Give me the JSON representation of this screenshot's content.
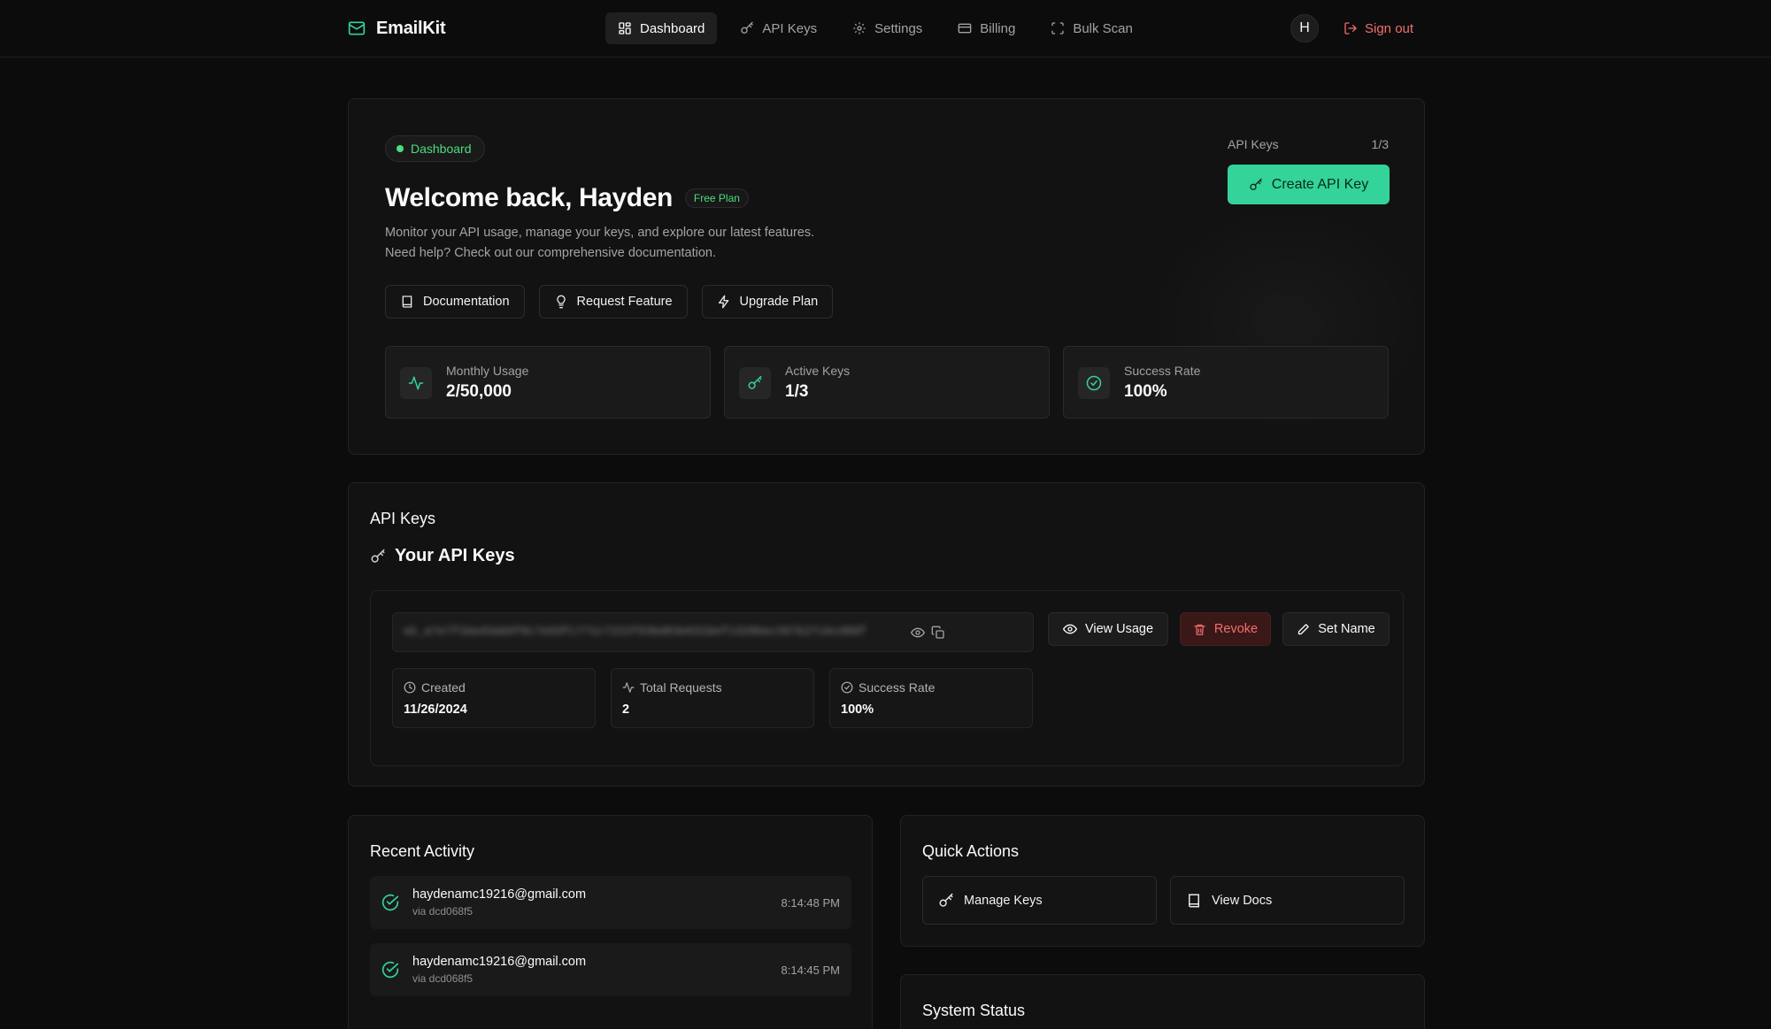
{
  "app": {
    "name": "EmailKit"
  },
  "nav": {
    "links": [
      {
        "label": "Dashboard",
        "icon": "dashboard-icon",
        "active": true
      },
      {
        "label": "API Keys",
        "icon": "key-icon"
      },
      {
        "label": "Settings",
        "icon": "gear-icon"
      },
      {
        "label": "Billing",
        "icon": "credit-card-icon"
      },
      {
        "label": "Bulk Scan",
        "icon": "scan-icon"
      }
    ],
    "avatar_initial": "H",
    "signout_label": "Sign out"
  },
  "hero": {
    "pill": "Dashboard",
    "title": "Welcome back, Hayden",
    "plan_badge": "Free Plan",
    "desc_line1": "Monitor your API usage, manage your keys, and explore our latest features.",
    "desc_line2": "Need help? Check out our comprehensive documentation.",
    "buttons": {
      "documentation": "Documentation",
      "request_feature": "Request Feature",
      "upgrade_plan": "Upgrade Plan"
    },
    "api_keys_label": "API Keys",
    "api_keys_count": "1/3",
    "create_button": "Create API Key",
    "stats": [
      {
        "label": "Monthly Usage",
        "value": "2/50,000",
        "icon": "activity-icon"
      },
      {
        "label": "Active Keys",
        "value": "1/3",
        "icon": "key-icon"
      },
      {
        "label": "Success Rate",
        "value": "100%",
        "icon": "check-circle-icon"
      }
    ]
  },
  "api_keys": {
    "section_title": "API Keys",
    "subtitle": "Your API Keys",
    "key_masked": "ek_a7e7f1bed3ab0f0c7e93fc771c7222f63bd03e031bef1328bec397b27cbcd88f",
    "buttons": {
      "view_usage": "View Usage",
      "revoke": "Revoke",
      "set_name": "Set Name"
    },
    "stats": [
      {
        "label": "Created",
        "value": "11/26/2024",
        "icon": "clock-icon"
      },
      {
        "label": "Total Requests",
        "value": "2",
        "icon": "activity-icon"
      },
      {
        "label": "Success Rate",
        "value": "100%",
        "icon": "check-circle-icon"
      }
    ]
  },
  "recent_activity": {
    "title": "Recent Activity",
    "items": [
      {
        "email": "haydenamc19216@gmail.com",
        "via": "via dcd068f5",
        "time": "8:14:48 PM"
      },
      {
        "email": "haydenamc19216@gmail.com",
        "via": "via dcd068f5",
        "time": "8:14:45 PM"
      }
    ]
  },
  "quick_actions": {
    "title": "Quick Actions",
    "manage_keys": "Manage Keys",
    "view_docs": "View Docs"
  },
  "system_status": {
    "title": "System Status"
  },
  "colors": {
    "accent": "#34d399",
    "danger": "#f26d6d",
    "background": "#0c0c0c"
  }
}
